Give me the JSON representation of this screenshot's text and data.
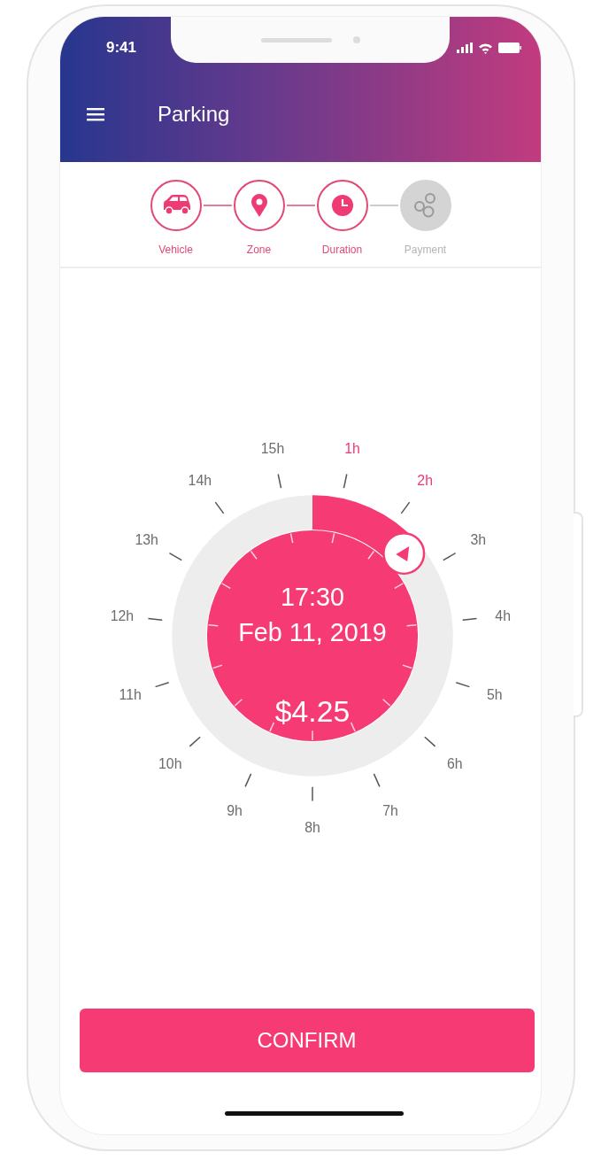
{
  "status_bar": {
    "time": "9:41"
  },
  "app_bar": {
    "title": "Parking"
  },
  "steps": [
    {
      "label": "Vehicle",
      "done": true
    },
    {
      "label": "Zone",
      "done": true
    },
    {
      "label": "Duration",
      "done": true
    },
    {
      "label": "Payment",
      "done": false
    }
  ],
  "dial": {
    "time": "17:30",
    "date": "Feb 11, 2019",
    "price": "$4.25",
    "hours": [
      {
        "label": "1h",
        "selected": true
      },
      {
        "label": "2h",
        "selected": true
      },
      {
        "label": "3h",
        "selected": false
      },
      {
        "label": "4h",
        "selected": false
      },
      {
        "label": "5h",
        "selected": false
      },
      {
        "label": "6h",
        "selected": false
      },
      {
        "label": "7h",
        "selected": false
      },
      {
        "label": "8h",
        "selected": false
      },
      {
        "label": "9h",
        "selected": false
      },
      {
        "label": "10h",
        "selected": false
      },
      {
        "label": "11h",
        "selected": false
      },
      {
        "label": "12h",
        "selected": false
      },
      {
        "label": "13h",
        "selected": false
      },
      {
        "label": "14h",
        "selected": false
      },
      {
        "label": "15h",
        "selected": false
      }
    ]
  },
  "confirm_button": {
    "label": "CONFIRM"
  }
}
